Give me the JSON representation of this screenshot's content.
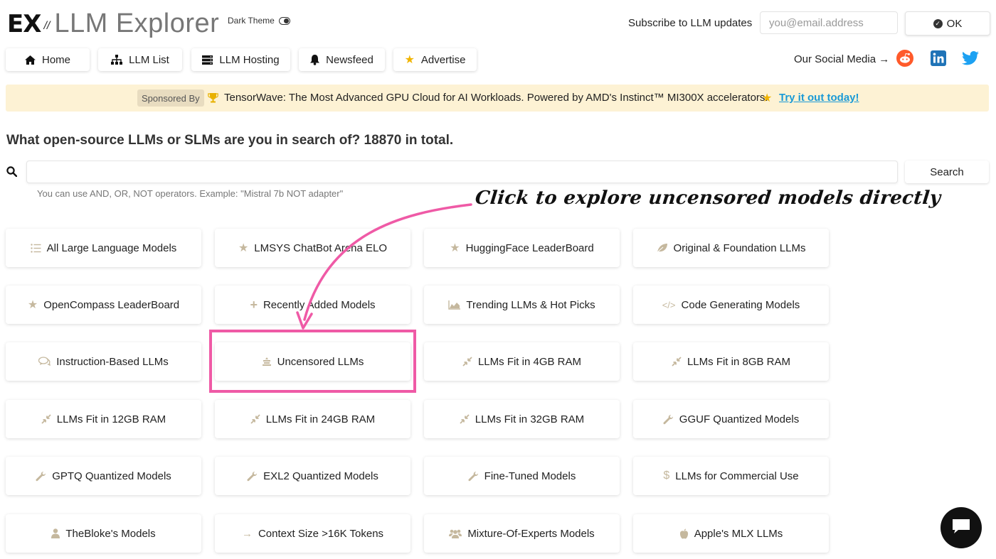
{
  "header": {
    "logo_mark": "EX",
    "logo_slash": "//",
    "logo_title": "LLM Explorer",
    "theme_label": "Dark Theme",
    "subscribe_label": "Subscribe to LLM updates",
    "email_placeholder": "you@email.address",
    "ok_label": "OK"
  },
  "nav": {
    "items": [
      {
        "label": "Home",
        "icon": "home-icon"
      },
      {
        "label": "LLM List",
        "icon": "sitemap-icon"
      },
      {
        "label": "LLM Hosting",
        "icon": "server-icon"
      },
      {
        "label": "Newsfeed",
        "icon": "bell-icon"
      },
      {
        "label": "Advertise",
        "icon": "star-icon"
      }
    ],
    "social_label": "Our Social Media →",
    "social": [
      "reddit-icon",
      "linkedin-icon",
      "twitter-icon"
    ]
  },
  "sponsor": {
    "tag": "Sponsored By",
    "text": "TensorWave: The Most Advanced GPU Cloud for AI Workloads. Powered by AMD's Instinct™ MI300X accelerators.",
    "link": "Try it out today!"
  },
  "search": {
    "heading": "What open-source LLMs or SLMs are you in search of? 18870 in total.",
    "placeholder": "",
    "button": "Search",
    "hint": "You can use AND, OR, NOT operators. Example: \"Mistral 7b NOT adapter\""
  },
  "annotation": {
    "text": "Click to explore uncensored models directly"
  },
  "categories": [
    {
      "label": "All Large Language Models",
      "icon": "list-icon"
    },
    {
      "label": "LMSYS ChatBot Arena ELO",
      "icon": "star-icon"
    },
    {
      "label": "HuggingFace LeaderBoard",
      "icon": "star-icon"
    },
    {
      "label": "Original & Foundation LLMs",
      "icon": "leaf-icon"
    },
    {
      "label": "OpenCompass LeaderBoard",
      "icon": "star-icon"
    },
    {
      "label": "Recently Added Models",
      "icon": "plus-icon"
    },
    {
      "label": "Trending LLMs & Hot Picks",
      "icon": "area-chart-icon"
    },
    {
      "label": "Code Generating Models",
      "icon": "code-icon"
    },
    {
      "label": "Instruction-Based LLMs",
      "icon": "comments-icon"
    },
    {
      "label": "Uncensored LLMs",
      "icon": "unlock-icon"
    },
    {
      "label": "LLMs Fit in 4GB RAM",
      "icon": "compress-icon"
    },
    {
      "label": "LLMs Fit in 8GB RAM",
      "icon": "compress-icon"
    },
    {
      "label": "LLMs Fit in 12GB RAM",
      "icon": "compress-icon"
    },
    {
      "label": "LLMs Fit in 24GB RAM",
      "icon": "compress-icon"
    },
    {
      "label": "LLMs Fit in 32GB RAM",
      "icon": "compress-icon"
    },
    {
      "label": "GGUF Quantized Models",
      "icon": "wrench-icon"
    },
    {
      "label": "GPTQ Quantized Models",
      "icon": "wrench-icon"
    },
    {
      "label": "EXL2 Quantized Models",
      "icon": "wrench-icon"
    },
    {
      "label": "Fine-Tuned Models",
      "icon": "wrench-icon"
    },
    {
      "label": "LLMs for Commercial Use",
      "icon": "dollar-icon"
    },
    {
      "label": "TheBloke's Models",
      "icon": "user-icon"
    },
    {
      "label": "Context Size >16K Tokens",
      "icon": "arrow-right-icon"
    },
    {
      "label": "Mixture-Of-Experts Models",
      "icon": "users-icon"
    },
    {
      "label": "Apple's MLX LLMs",
      "icon": "apple-icon"
    }
  ],
  "colors": {
    "accent_pink": "#ef5aa6",
    "sponsor_bg": "#fdf2d4",
    "link_blue": "#1a9ad6",
    "icon_beige": "#c5b89e"
  }
}
